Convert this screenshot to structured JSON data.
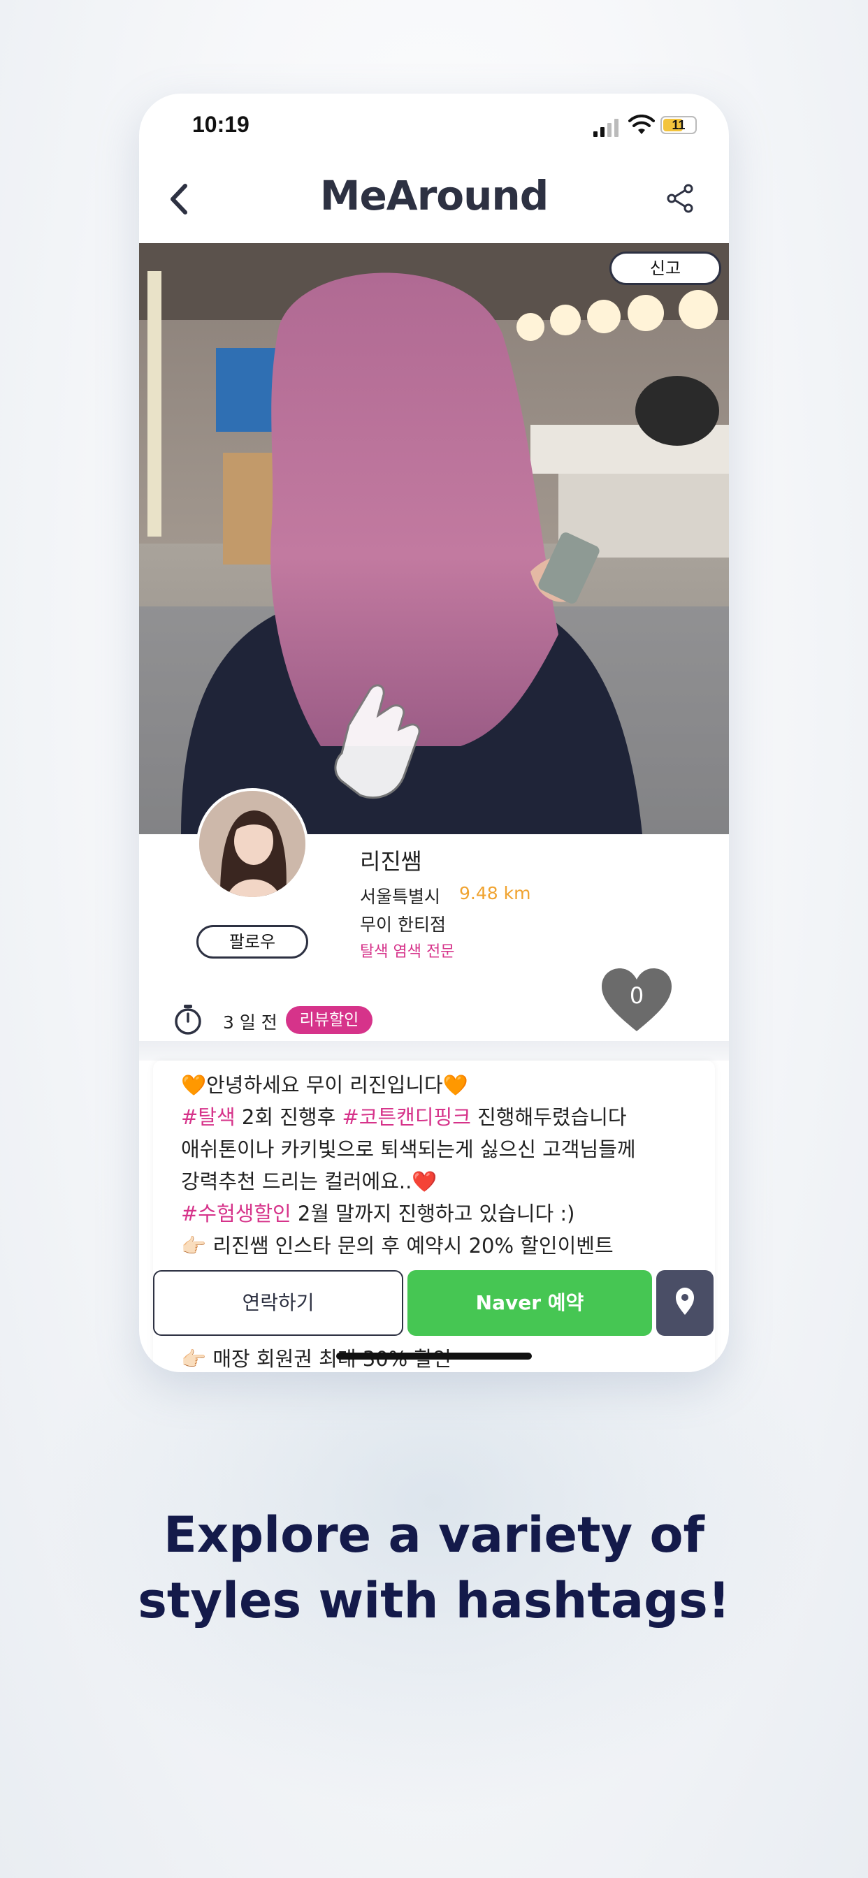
{
  "status_bar": {
    "time": "10:19",
    "battery": "11"
  },
  "app_bar": {
    "title": "MeAround"
  },
  "photo": {
    "report_label": "신고"
  },
  "profile": {
    "follow_label": "팔로우",
    "name": "리진쌤",
    "city": "서울특별시",
    "distance": "9.48 km",
    "shop": "무이 한티점",
    "specialty": "탈색 염색 전문",
    "posted_ago": "3 일 전",
    "badge": "리뷰할인",
    "like_count": "0"
  },
  "post": {
    "line1": "🧡안녕하세요 무이 리진입니다🧡",
    "line2_tag1": "#탈색",
    "line2_mid": " 2회 진행후 ",
    "line2_tag2": "#코튼캔디핑크",
    "line2_end": " 진행해두렸습니다",
    "line3": "애쉬톤이나 카키빛으로 퇴색되는게 싫으신 고객님들께",
    "line4": "강력추천 드리는 컬러에요..❤️",
    "line5_tag": "#수험생할인",
    "line5_end": " 2월 말까지 진행하고 있습니다 :)",
    "line6": "👉🏻 리진쌤 인스타 문의 후 예약시 20% 할인이벤트",
    "line7": "👉🏻 매장 회원권 최대 30% 할인"
  },
  "actions": {
    "contact_label": "연락하기",
    "naver_label": "Naver 예약"
  },
  "caption": {
    "line1": "Explore a variety of",
    "line2": "styles with hashtags!"
  },
  "colors": {
    "brand_navy": "#2d3142",
    "hashtag_pink": "#d6338a",
    "distance_orange": "#f0a330",
    "naver_green": "#46c653",
    "caption_navy": "#141a4a"
  }
}
